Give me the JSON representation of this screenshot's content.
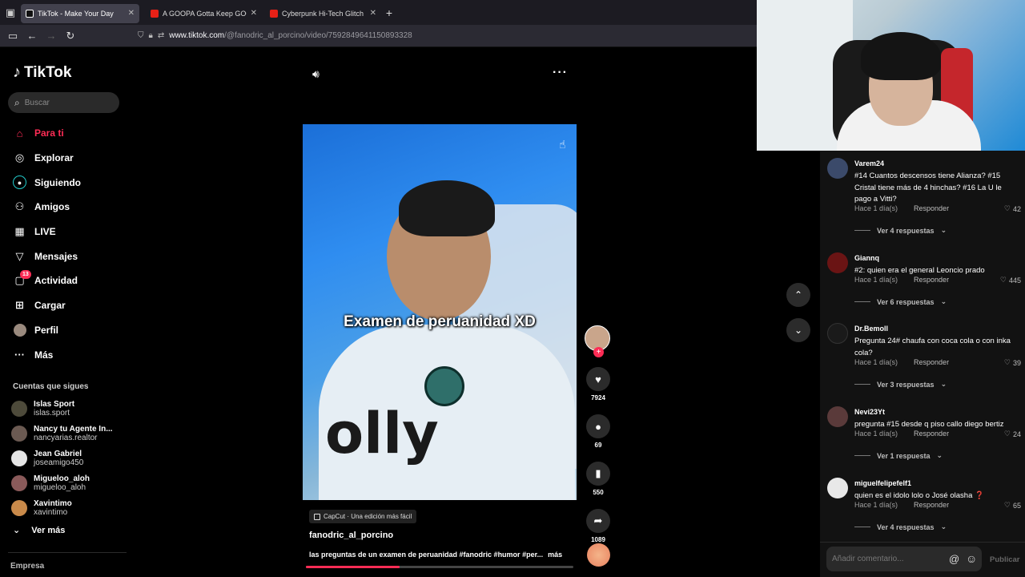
{
  "browser": {
    "tabs": [
      {
        "title": "TikTok - Make Your Day",
        "active": true
      },
      {
        "title": "A GOOPA Gotta Keep GOOPIN",
        "active": false
      },
      {
        "title": "Cyberpunk Hi-Tech Glitch Neon",
        "active": false
      }
    ],
    "url_host": "www.tiktok.com",
    "url_path": "/@fanodric_al_porcino/video/7592849641150893328"
  },
  "sidebar": {
    "logo": "TikTok",
    "search_placeholder": "Buscar",
    "nav": [
      {
        "label": "Para ti",
        "icon": "home-icon",
        "active": true
      },
      {
        "label": "Explorar",
        "icon": "compass-icon"
      },
      {
        "label": "Siguiendo",
        "icon": "following-icon"
      },
      {
        "label": "Amigos",
        "icon": "friends-icon"
      },
      {
        "label": "LIVE",
        "icon": "live-icon"
      },
      {
        "label": "Mensajes",
        "icon": "messages-icon"
      },
      {
        "label": "Actividad",
        "icon": "activity-icon",
        "badge": "13"
      },
      {
        "label": "Cargar",
        "icon": "upload-icon"
      },
      {
        "label": "Perfil",
        "icon": "profile-icon"
      },
      {
        "label": "Más",
        "icon": "more-icon"
      }
    ],
    "following_header": "Cuentas que sigues",
    "following": [
      {
        "name": "Islas Sport",
        "handle": "islas.sport"
      },
      {
        "name": "Nancy tu Agente In...",
        "handle": "nancyarias.realtor"
      },
      {
        "name": "Jean Gabriel",
        "handle": "joseamigo450"
      },
      {
        "name": "Migueloo_aloh",
        "handle": "migueloo_aloh"
      },
      {
        "name": "Xavintimo",
        "handle": "xavintimo"
      }
    ],
    "see_more": "Ver más",
    "company": "Empresa"
  },
  "video": {
    "overlay_caption": "Examen de peruanidad XD",
    "sponsor_text": "olly",
    "capcut_label": "CapCut · Una edición más fácil",
    "author": "fanodric_al_porcino",
    "description": "las preguntas de un examen de peruanidad #fanodric #humor #per...",
    "more": "más",
    "progress": 0.35,
    "likes": "7924",
    "comments": "69",
    "saves": "550",
    "shares": "1089"
  },
  "comments": [
    {
      "user": "Varem24",
      "text": "#14 Cuantos descensos tiene Alianza? #15 Cristal tiene más de 4 hinchas? #16 La U le pago a Vitti?",
      "time": "Hace 1 día(s)",
      "reply": "Responder",
      "likes": "42",
      "replies": "Ver 4 respuestas"
    },
    {
      "user": "Giannq",
      "text": "#2: quien era el general Leoncio prado",
      "time": "Hace 1 día(s)",
      "reply": "Responder",
      "likes": "445",
      "replies": "Ver 6 respuestas"
    },
    {
      "user": "Dr.Bemoll",
      "text": "Pregunta 24# chaufa con coca cola o con inka cola?",
      "time": "Hace 1 día(s)",
      "reply": "Responder",
      "likes": "39",
      "replies": "Ver 3 respuestas"
    },
    {
      "user": "Nevi23Yt",
      "text": "pregunta #15 desde q piso callo diego bertiz",
      "time": "Hace 1 día(s)",
      "reply": "Responder",
      "likes": "24",
      "replies": "Ver 1 respuesta"
    },
    {
      "user": "miguelfelipefelf1",
      "text": "quien es el idolo lolo o José olasha ❓",
      "time": "Hace 1 día(s)",
      "reply": "Responder",
      "likes": "65",
      "replies": "Ver 4 respuestas"
    }
  ],
  "compose": {
    "placeholder": "Añadir comentario...",
    "publish": "Publicar"
  }
}
